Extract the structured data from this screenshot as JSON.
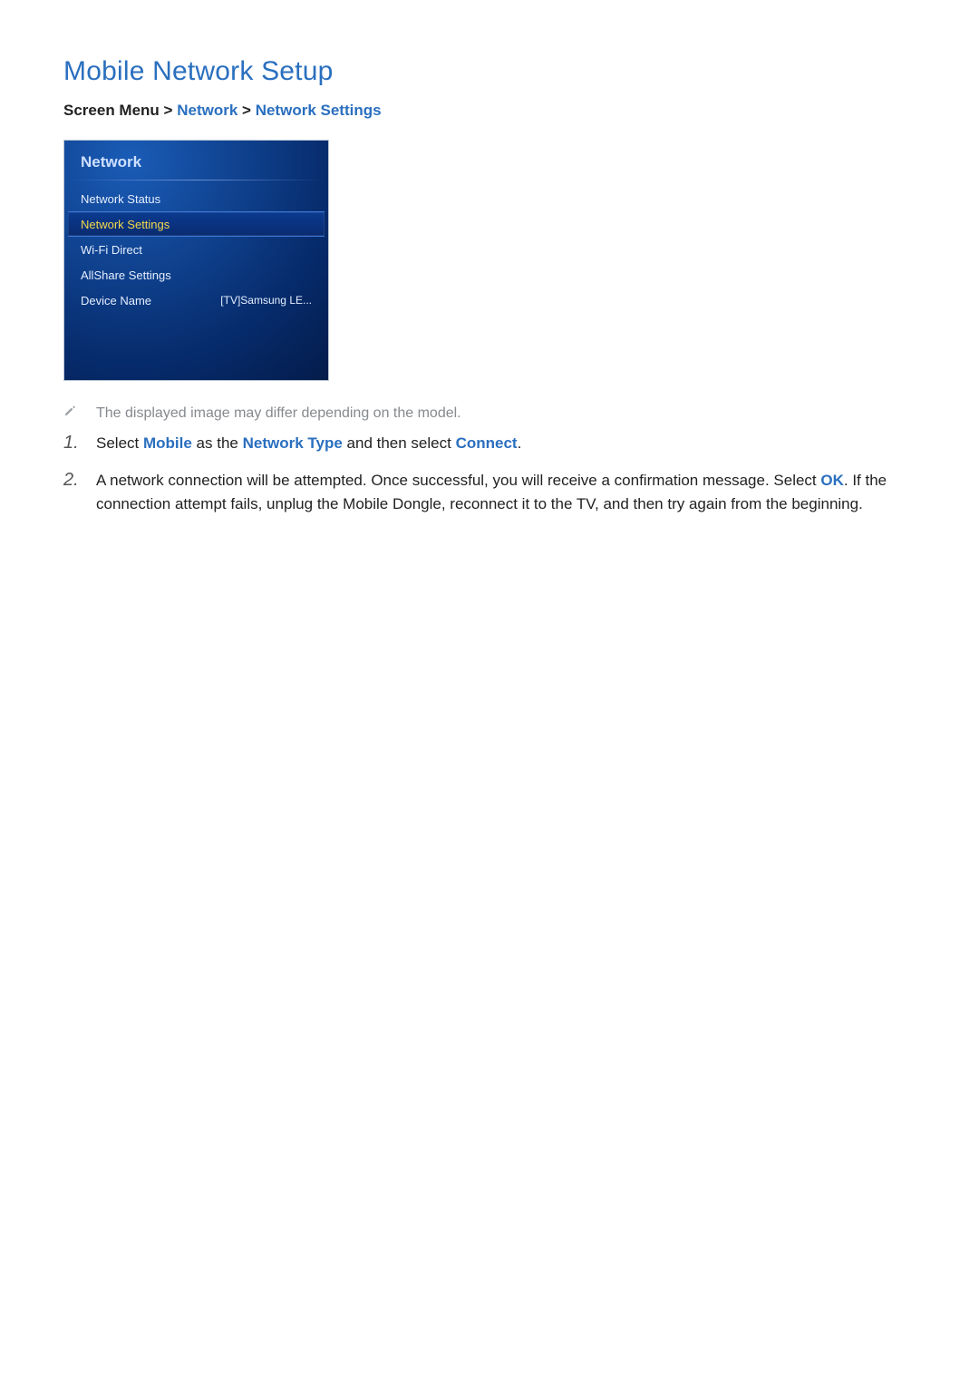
{
  "title": "Mobile Network Setup",
  "breadcrumb": {
    "prefix": "Screen Menu",
    "sep": ">",
    "crumb1": "Network",
    "crumb2": "Network Settings"
  },
  "tv": {
    "title": "Network",
    "items": [
      {
        "label": "Network Status",
        "value": "",
        "selected": false
      },
      {
        "label": "Network Settings",
        "value": "",
        "selected": true
      },
      {
        "label": "Wi-Fi Direct",
        "value": "",
        "selected": false
      },
      {
        "label": "AllShare Settings",
        "value": "",
        "selected": false
      },
      {
        "label": "Device Name",
        "value": "[TV]Samsung LE...",
        "selected": false
      }
    ]
  },
  "note": "The displayed image may differ depending on the model.",
  "steps": [
    {
      "marker": "1.",
      "parts": {
        "t1": "Select ",
        "k1": "Mobile",
        "t2": " as the ",
        "k2": "Network Type",
        "t3": " and then select ",
        "k3": "Connect",
        "t4": "."
      }
    },
    {
      "marker": "2.",
      "parts": {
        "t1": "A network connection will be attempted. Once successful, you will receive a confirmation message. Select ",
        "k1": "OK",
        "t2": ". If the connection attempt fails, unplug the Mobile Dongle, reconnect it to the TV, and then try again from the beginning."
      }
    }
  ]
}
